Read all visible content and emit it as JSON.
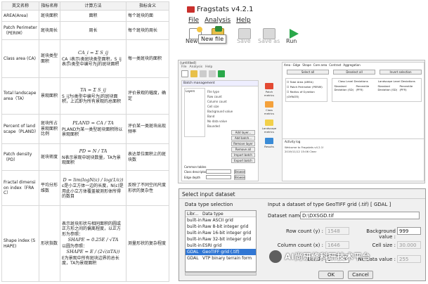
{
  "table": {
    "headers": [
      "英文名称",
      "指标名称",
      "计算方法",
      "指标含义"
    ],
    "rows": [
      {
        "en": "AREA(Area)",
        "cn": "斑块面积",
        "method": "面积",
        "meaning": "每个斑块的面"
      },
      {
        "en": "Patch Perimeter（PERIM）",
        "cn": "斑块周长",
        "method": "周长",
        "meaning": "每个斑块的周长"
      },
      {
        "en": "Class area (CA)",
        "cn": "斑块类型面积",
        "formula": "CA_i = Σ S_ij",
        "method": "CA_i表示i类斑块类型面积，S_ij表示i类型中编号为j的斑块面积",
        "meaning": "每一类斑块的面积"
      },
      {
        "en": "Total landscape area（TA）",
        "cn": "景观面积",
        "formula": "TA = Σ S_ij",
        "method": "S_ij为i类型中编号为j的斑块面积，上式即为所有景观的总面积",
        "meaning": "评价景观的幅度，确定"
      },
      {
        "en": "Percent of landscape（PLAND）",
        "cn": "斑块所占景观面积比例",
        "formula": "PLAND = CA / TA",
        "method": "PLAND为某一类型斑块面积除以景观面积",
        "meaning": "评价某一类斑块出现频率"
      },
      {
        "en": "Patch density（PD）",
        "cn": "斑块密度",
        "formula": "PD = N / TA",
        "method": "N表示景观中斑块数量，TA为景观面积",
        "meaning": "表达单位面积上的斑块数"
      },
      {
        "en": "Fractal dimension index（FRAC）",
        "cn": "平均分形维数",
        "formula": "D = lim(logN(ε) / log(1/ε))",
        "method": "ε是小立方体一边的长度，N(ε)是用此小立方体覆盖被测形体所得的数目",
        "meaning": "反映了不同空间尺度形状的复杂性"
      },
      {
        "en": "Shape index (SHAPE)",
        "cn": "形状指数",
        "method": "表示斑块形状与相同面积的圆或正方形之间的偏离程度，以正方形为参照：",
        "formula": "SHAPE = 0.25E / √TA",
        "method2": "以圆为参照：",
        "formula2": "SHAPE = E / (2√(πTA))",
        "method3": "E为景观中所有斑块边界的总长度，TA为景观面积",
        "meaning": "测量形状的复杂程度"
      }
    ]
  },
  "fragstats": {
    "title": "Fragstats v4.2.1",
    "menu": [
      "File",
      "Analysis",
      "Help"
    ],
    "toolbar": [
      {
        "label": "New",
        "icon": "new-model-icon"
      },
      {
        "label": "Open",
        "icon": "open-folder-icon"
      },
      {
        "label": "Save",
        "icon": "save-icon"
      },
      {
        "label": "Save as",
        "icon": "save-as-icon"
      },
      {
        "label": "Run",
        "icon": "run-icon"
      }
    ],
    "tooltip": "New file"
  },
  "mid_app": {
    "title": "(untitled)",
    "menu": [
      "File",
      "Analysis",
      "Help"
    ],
    "batch_panel": {
      "title": "Batch management",
      "input_layers": "Layers",
      "fields": [
        "File type",
        "Row count",
        "Column count",
        "Cell size",
        "Background value",
        "Band",
        "No data value",
        "Bounded"
      ],
      "buttons": [
        "Add layer...",
        "Add batch...",
        "Remove layer",
        "Remove all",
        "Import batch",
        "Export batch"
      ],
      "common_tables": "Common tables",
      "class_descriptors": "Class descriptors",
      "edge_depth": "Edge depth",
      "use_fixed_depth": "Use fixed depth",
      "browse": "Browse"
    },
    "side_tools": [
      "Patch metrics",
      "Class metrics",
      "Landscape metrics",
      "Results"
    ],
    "analysis": {
      "tabs": [
        "Area - Edge",
        "Shape",
        "Core area",
        "Contrast",
        "Aggregation"
      ],
      "select_all": "Select all",
      "deselect_all": "Deselect all",
      "invert_selection": "Invert selection",
      "metrics": [
        "Total Area (AREA)",
        "Patch Perimeter (PERIM)",
        "Radius of Gyration (GYRATE)"
      ],
      "distribution_headers": [
        "Class Level Deviations",
        "Landscape Level Deviations"
      ],
      "stat_columns": [
        "Standard Deviation (SD)",
        "Percentile (PFR)",
        "Standard Deviation (SD)",
        "Percentile (PFR)"
      ],
      "activity_log": "Activity log",
      "log_lines": [
        "Welcome to Fragstats v4.2.1!",
        "2019/11/12 15:06 Clear"
      ]
    }
  },
  "dialog": {
    "title": "Select input dataset",
    "data_type_label": "Data type selection",
    "dt_header": {
      "lib": "Libr...",
      "type": "Data type"
    },
    "data_types": [
      {
        "lib": "built-in",
        "type": "Raw ASCII grid"
      },
      {
        "lib": "built-in",
        "type": "Raw 8-bit integer grid"
      },
      {
        "lib": "built-in",
        "type": "Raw 16-bit integer grid"
      },
      {
        "lib": "built-in",
        "type": "Raw 32-bit integer grid"
      },
      {
        "lib": "built-in",
        "type": "ESRI grid"
      },
      {
        "lib": "GDAL",
        "type": "GeoTIFF grid (.tif)",
        "selected": true
      },
      {
        "lib": "GDAL",
        "type": "VTP binary terrain form"
      }
    ],
    "input_label": "Input a dataset of type GeoTIFF grid (.tif) [ GDAL ]",
    "dataset_name_label": "Dataset name:",
    "dataset_name": "D:\\DXSGD.tif",
    "row_count_label": "Row count (y) :",
    "row_count": "1548",
    "background_label": "Background value :",
    "background": "999",
    "column_count_label": "Column count (x) :",
    "column_count": "1646",
    "cell_size_label": "Cell size :",
    "cell_size": "30.000",
    "band_label": "Band :",
    "band": "1",
    "nodata_label": "No data value :",
    "nodata": "255",
    "ok": "OK",
    "cancel": "Cancel"
  },
  "watermark": "AI尚研修科研技术平台",
  "colors": {
    "accent": "#3177d4",
    "run_green": "#2aa84a",
    "fragstats_red": "#c9302c"
  }
}
